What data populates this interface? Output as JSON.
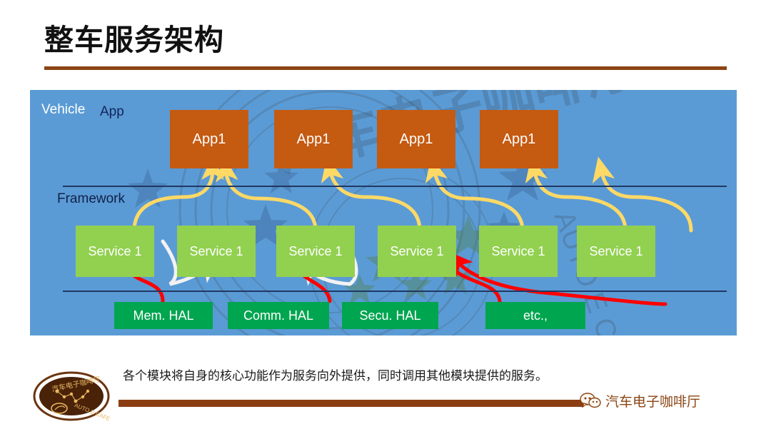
{
  "slide": {
    "title": "整车服务架构",
    "caption": "各个模块将自身的核心功能作为服务向外提供，同时调用其他模块提供的服务。"
  },
  "colors": {
    "title_rule": "#8B4513",
    "panel_bg": "#5B9BD5",
    "app_box": "#C55A11",
    "service_box": "#92D050",
    "hal_box": "#00A550",
    "app_arrow": "#FFD966",
    "service_arrow": "#FFFFFF",
    "hal_arrow": "#FF0000",
    "divider": "#203864",
    "footer_rule": "#8B3E13",
    "brand": "#8B4513"
  },
  "diagram": {
    "labels": {
      "vehicle": "Vehicle",
      "app": "App",
      "framework": "Framework"
    },
    "app_layer": [
      {
        "label": "App1"
      },
      {
        "label": "App1"
      },
      {
        "label": "App1"
      },
      {
        "label": "App1"
      }
    ],
    "service_layer": [
      {
        "label": "Service 1"
      },
      {
        "label": "Service 1"
      },
      {
        "label": "Service 1"
      },
      {
        "label": "Service 1"
      },
      {
        "label": "Service 1"
      },
      {
        "label": "Service 1"
      }
    ],
    "hal_layer": [
      {
        "label": "Mem. HAL"
      },
      {
        "label": "Comm. HAL"
      },
      {
        "label": "Secu. HAL"
      },
      {
        "label": "etc.,"
      }
    ]
  },
  "footer": {
    "logo_top_text": "汽车电子咖啡厅",
    "logo_bottom_text": "AUTO E CAFE",
    "wechat_label": "汽车电子咖啡厅",
    "wechat_icon": "wechat-icon"
  },
  "watermark": {
    "text": "汽车电子咖啡厅",
    "sub_text": "AUTO E CAFE"
  }
}
